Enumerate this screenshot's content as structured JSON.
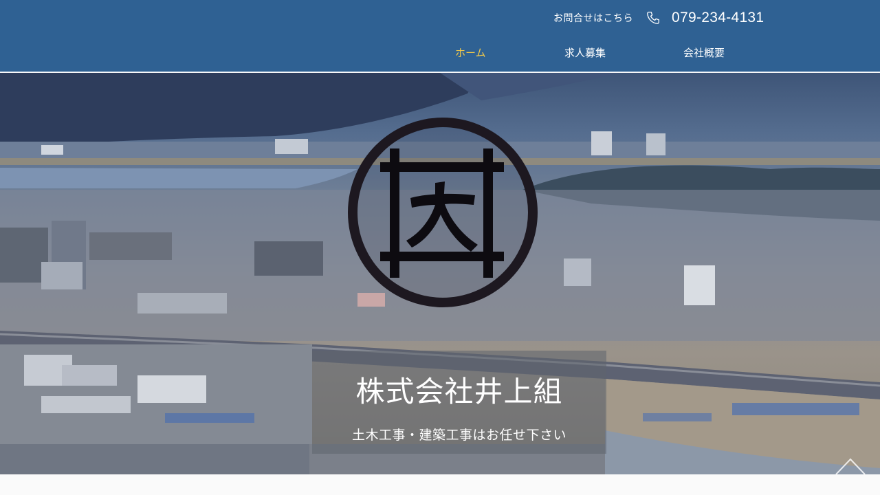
{
  "header": {
    "contact_label": "お問合せはこちら",
    "phone_icon": "phone-icon",
    "phone_number": "079-234-4131",
    "nav": [
      {
        "label": "ホーム",
        "active": true
      },
      {
        "label": "求人募集",
        "active": false
      },
      {
        "label": "会社概要",
        "active": false
      }
    ]
  },
  "hero": {
    "logo_icon": "company-crest-icon",
    "company_name": "株式会社井上組",
    "tagline": "土木工事・建築工事はお任せ下さい"
  },
  "colors": {
    "header_bg": "#2f6193",
    "nav_active": "#f1c84a",
    "text": "#ffffff"
  }
}
